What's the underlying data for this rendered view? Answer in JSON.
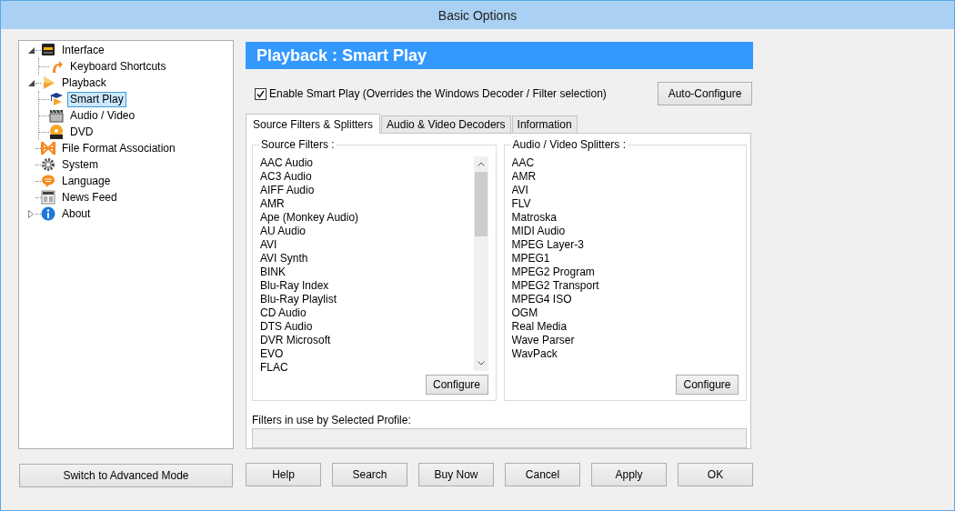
{
  "window": {
    "title": "Basic Options"
  },
  "sidebar": {
    "items": [
      {
        "label": "Interface",
        "selected": false,
        "expanded": true,
        "children": [
          {
            "label": "Keyboard Shortcuts",
            "selected": false
          }
        ]
      },
      {
        "label": "Playback",
        "selected": false,
        "expanded": true,
        "children": [
          {
            "label": "Smart Play",
            "selected": true
          },
          {
            "label": "Audio / Video",
            "selected": false
          },
          {
            "label": "DVD",
            "selected": false
          }
        ]
      },
      {
        "label": "File Format Association",
        "selected": false
      },
      {
        "label": "System",
        "selected": false
      },
      {
        "label": "Language",
        "selected": false
      },
      {
        "label": "News Feed",
        "selected": false
      },
      {
        "label": "About",
        "selected": false,
        "expanded": false
      }
    ]
  },
  "mode_button": "Switch to Advanced Mode",
  "page": {
    "title": "Playback : Smart Play"
  },
  "enable_option": {
    "label": "Enable Smart Play (Overrides the Windows Decoder / Filter selection)",
    "checked": true
  },
  "auto_configure_button": "Auto-Configure",
  "tabs": [
    {
      "label": "Source Filters & Splitters",
      "selected": true
    },
    {
      "label": "Audio & Video Decoders",
      "selected": false
    },
    {
      "label": "Information",
      "selected": false
    }
  ],
  "source_filters": {
    "title": "Source Filters :",
    "items": [
      "AAC Audio",
      "AC3 Audio",
      "AIFF Audio",
      "AMR",
      "Ape (Monkey Audio)",
      "AU Audio",
      "AVI",
      "AVI Synth",
      "BINK",
      "Blu-Ray Index",
      "Blu-Ray Playlist",
      "CD Audio",
      "DTS Audio",
      "DVR Microsoft",
      "EVO",
      "FLAC"
    ],
    "button": "Configure"
  },
  "splitters": {
    "title": "Audio / Video Splitters :",
    "items": [
      "AAC",
      "AMR",
      "AVI",
      "FLV",
      "Matroska",
      "MIDI Audio",
      "MPEG Layer-3",
      "MPEG1",
      "MPEG2 Program",
      "MPEG2 Transport",
      "MPEG4 ISO",
      "OGM",
      "Real Media",
      "Wave Parser",
      "WavPack"
    ],
    "button": "Configure"
  },
  "profile_filters": {
    "label": "Filters in use by Selected Profile:"
  },
  "buttons": [
    "Help",
    "Search",
    "Buy Now",
    "Cancel",
    "Apply",
    "OK"
  ]
}
